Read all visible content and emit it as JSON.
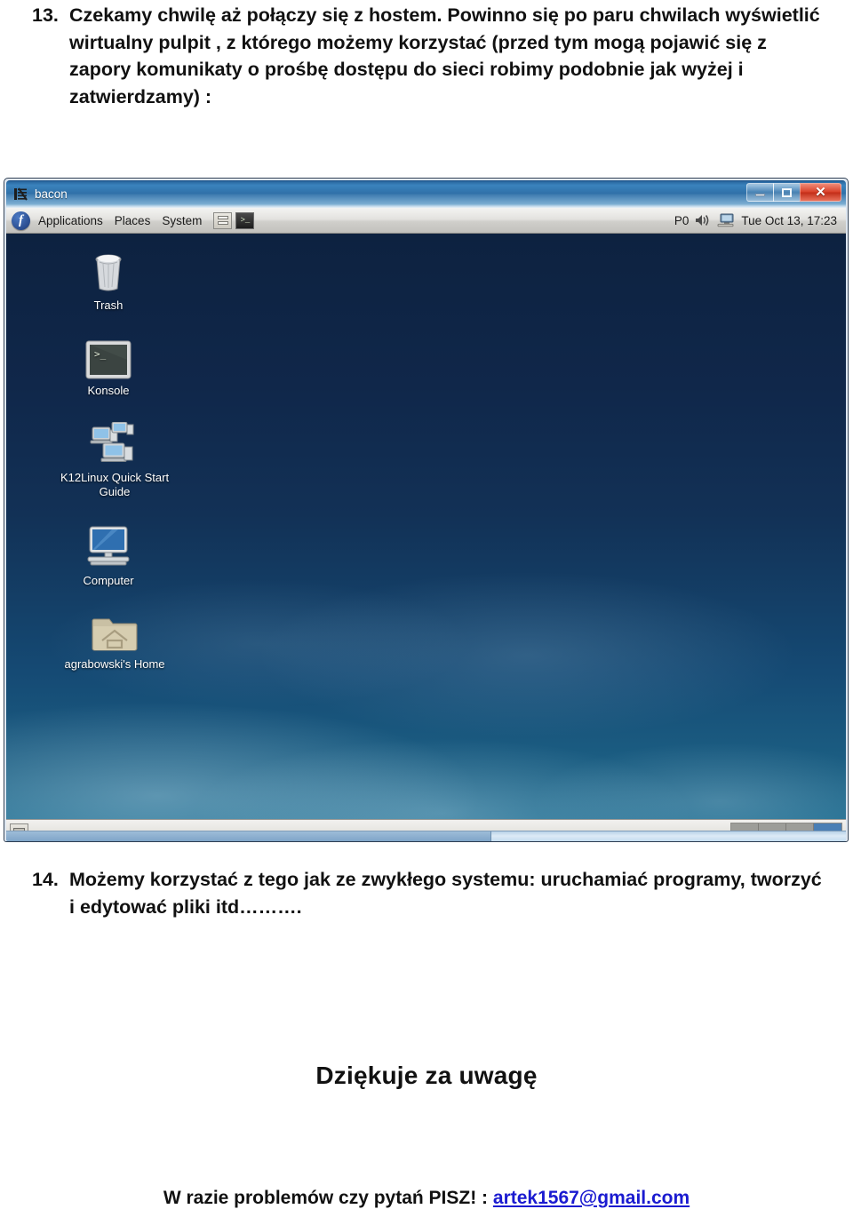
{
  "document": {
    "step13": {
      "number": "13.",
      "text": "Czekamy chwilę aż połączy się z hostem. Powinno się po paru chwilach wyświetlić wirtualny pulpit , z którego możemy korzystać (przed tym mogą pojawić się z zapory komunikaty o prośbę dostępu do sieci robimy podobnie jak wyżej i zatwierdzamy) :"
    },
    "step14": {
      "number": "14.",
      "text": "Możemy korzystać z tego jak ze zwykłego systemu: uruchamiać programy, tworzyć i edytować pliki itd………."
    },
    "thanks": "Dziękuje za uwagę",
    "contact_prefix": "W razie problemów czy pytań PISZ! : ",
    "contact_email": "artek1567@gmail.com",
    "link_color": "#1a1ad0"
  },
  "screenshot": {
    "window": {
      "title": "bacon",
      "title_icon": "vnc-viewer-icon",
      "controls": {
        "minimize": "minimize-icon",
        "maximize": "maximize-icon",
        "close": "✕"
      },
      "titlebar_color": "#3b83bd",
      "close_color": "#d9412a"
    },
    "top_panel": {
      "logo": "fedora-logo",
      "menus": [
        "Applications",
        "Places",
        "System"
      ],
      "launchers": [
        "file-manager-icon",
        "terminal-icon"
      ],
      "tray": {
        "label": "P0",
        "volume_icon": "volume-icon",
        "display_icon": "display-icon",
        "clock": "Tue Oct 13, 17:23"
      }
    },
    "desktop": {
      "background": "#123156",
      "icons": [
        {
          "name": "Trash",
          "icon": "trash-icon"
        },
        {
          "name": "Konsole",
          "icon": "terminal-icon"
        },
        {
          "name": "K12Linux Quick Start Guide",
          "icon": "computers-icon"
        },
        {
          "name": "Computer",
          "icon": "computer-icon"
        },
        {
          "name": "agrabowski's Home",
          "icon": "home-folder-icon"
        }
      ]
    },
    "bottom_panel": {
      "show_desktop": "show-desktop-icon",
      "workspaces": [
        "1",
        "2",
        "3",
        "4"
      ],
      "active_workspace": 4,
      "active_color": "#4a7fb5"
    }
  }
}
